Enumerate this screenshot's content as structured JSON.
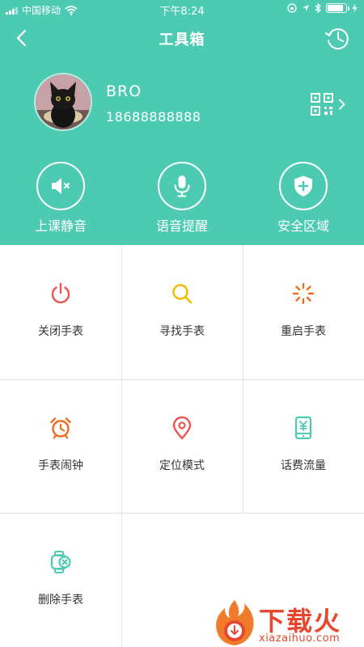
{
  "status_bar": {
    "carrier": "中国移动",
    "time": "下午8:24",
    "battery_level": 0.85
  },
  "nav": {
    "title": "工具箱",
    "back_icon": "chevron-left-icon",
    "history_icon": "history-clock-icon"
  },
  "profile": {
    "name": "BRO",
    "phone": "18688888888",
    "qr_icon": "qr-code-icon"
  },
  "quick_actions": [
    {
      "label": "上课静音",
      "icon": "mute-speaker-icon"
    },
    {
      "label": "语音提醒",
      "icon": "microphone-icon"
    },
    {
      "label": "安全区域",
      "icon": "shield-plus-icon"
    }
  ],
  "tools": [
    {
      "label": "关闭手表",
      "icon": "power-icon",
      "color": "#ef5350"
    },
    {
      "label": "寻找手表",
      "icon": "search-icon",
      "color": "#f5b800"
    },
    {
      "label": "重启手表",
      "icon": "restart-spinner-icon",
      "color": "#f26b1d"
    },
    {
      "label": "手表闹钟",
      "icon": "alarm-clock-icon",
      "color": "#f26b1d"
    },
    {
      "label": "定位模式",
      "icon": "location-pin-icon",
      "color": "#ef5350"
    },
    {
      "label": "话费流量",
      "icon": "phone-bill-icon",
      "color": "#4dcbb2"
    },
    {
      "label": "删除手表",
      "icon": "delete-watch-icon",
      "color": "#4dcbb2"
    }
  ],
  "watermark": {
    "text": "下载火",
    "url": "xiazaihuo.com"
  },
  "colors": {
    "header_bg": "#4dcbb2",
    "divider": "#e3e3e3",
    "watermark": "#e8472d"
  }
}
